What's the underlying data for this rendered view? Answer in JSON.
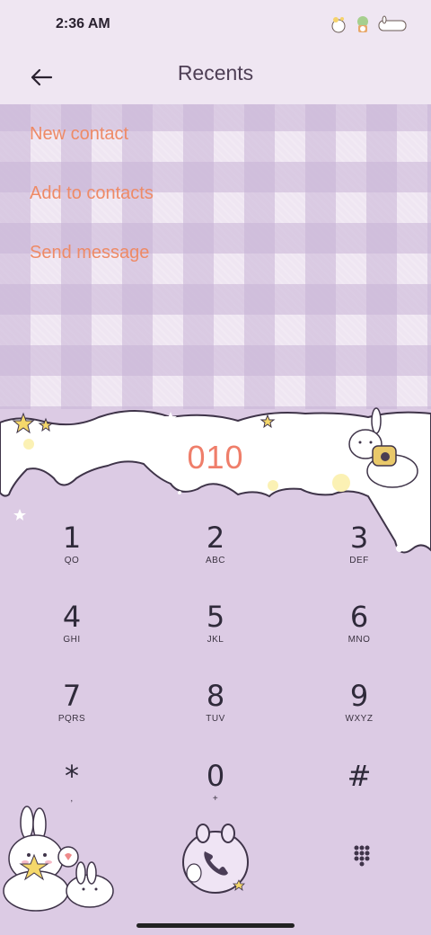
{
  "status_bar": {
    "time": "2:36 AM",
    "icons": [
      "bunny-sticker-icon",
      "bunny-plant-icon",
      "bunny-cloud-icon"
    ]
  },
  "header": {
    "title": "Recents",
    "back_icon": "arrow-left-icon"
  },
  "menu": {
    "items": [
      {
        "label": "New contact"
      },
      {
        "label": "Add to contacts"
      },
      {
        "label": "Send message"
      }
    ]
  },
  "dialer": {
    "number": "010",
    "keys": [
      {
        "digit": "1",
        "letters": "QO"
      },
      {
        "digit": "2",
        "letters": "ABC"
      },
      {
        "digit": "3",
        "letters": "DEF"
      },
      {
        "digit": "4",
        "letters": "GHI"
      },
      {
        "digit": "5",
        "letters": "JKL"
      },
      {
        "digit": "6",
        "letters": "MNO"
      },
      {
        "digit": "7",
        "letters": "PQRS"
      },
      {
        "digit": "8",
        "letters": "TUV"
      },
      {
        "digit": "9",
        "letters": "WXYZ"
      },
      {
        "digit": "*",
        "letters": ","
      },
      {
        "digit": "0",
        "letters": "+"
      },
      {
        "digit": "#",
        "letters": ""
      }
    ],
    "call_icon": "phone-icon",
    "keypad_icon": "dialpad-icon"
  },
  "colors": {
    "accent": "#ee8a66",
    "number": "#ef7e6a",
    "background": "#efe6f2",
    "dial_background": "#dccbe4"
  }
}
